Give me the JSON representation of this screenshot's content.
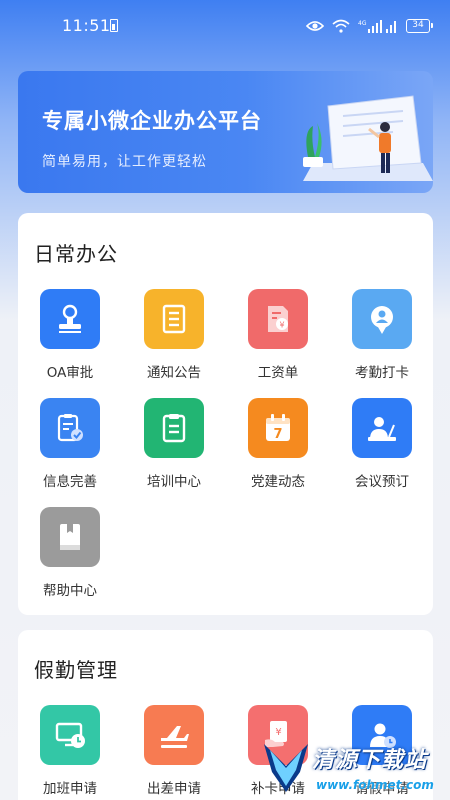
{
  "status_bar": {
    "time": "11:51",
    "network": "4G",
    "battery": "34"
  },
  "banner": {
    "title": "专属小微企业办公平台",
    "subtitle": "简单易用，让工作更轻松"
  },
  "daily": {
    "title": "日常办公",
    "items": [
      {
        "label": "OA审批",
        "icon": "stamp-icon",
        "color": "#2f7cf6"
      },
      {
        "label": "通知公告",
        "icon": "notice-icon",
        "color": "#f7b32b"
      },
      {
        "label": "工资单",
        "icon": "salary-icon",
        "color": "#f06a6a"
      },
      {
        "label": "考勤打卡",
        "icon": "location-icon",
        "color": "#5aa9f2"
      },
      {
        "label": "信息完善",
        "icon": "info-check-icon",
        "color": "#3a84f2"
      },
      {
        "label": "培训中心",
        "icon": "clipboard-icon",
        "color": "#22b573"
      },
      {
        "label": "党建动态",
        "icon": "calendar-icon",
        "color": "#f58a1f"
      },
      {
        "label": "会议预订",
        "icon": "meeting-icon",
        "color": "#2f7cf6"
      },
      {
        "label": "帮助中心",
        "icon": "book-icon",
        "color": "#9b9b9b"
      }
    ]
  },
  "leave": {
    "title": "假勤管理",
    "items": [
      {
        "label": "加班申请",
        "icon": "overtime-icon",
        "color": "#33c7a6"
      },
      {
        "label": "出差申请",
        "icon": "plane-icon",
        "color": "#f77b52"
      },
      {
        "label": "补卡申请",
        "icon": "card-hand-icon",
        "color": "#f46f6f"
      },
      {
        "label": "请假申请",
        "icon": "person-clock-icon",
        "color": "#2f7cf6"
      }
    ]
  },
  "watermark": {
    "text": "清源下载站",
    "url": "www.fohmet.com"
  }
}
